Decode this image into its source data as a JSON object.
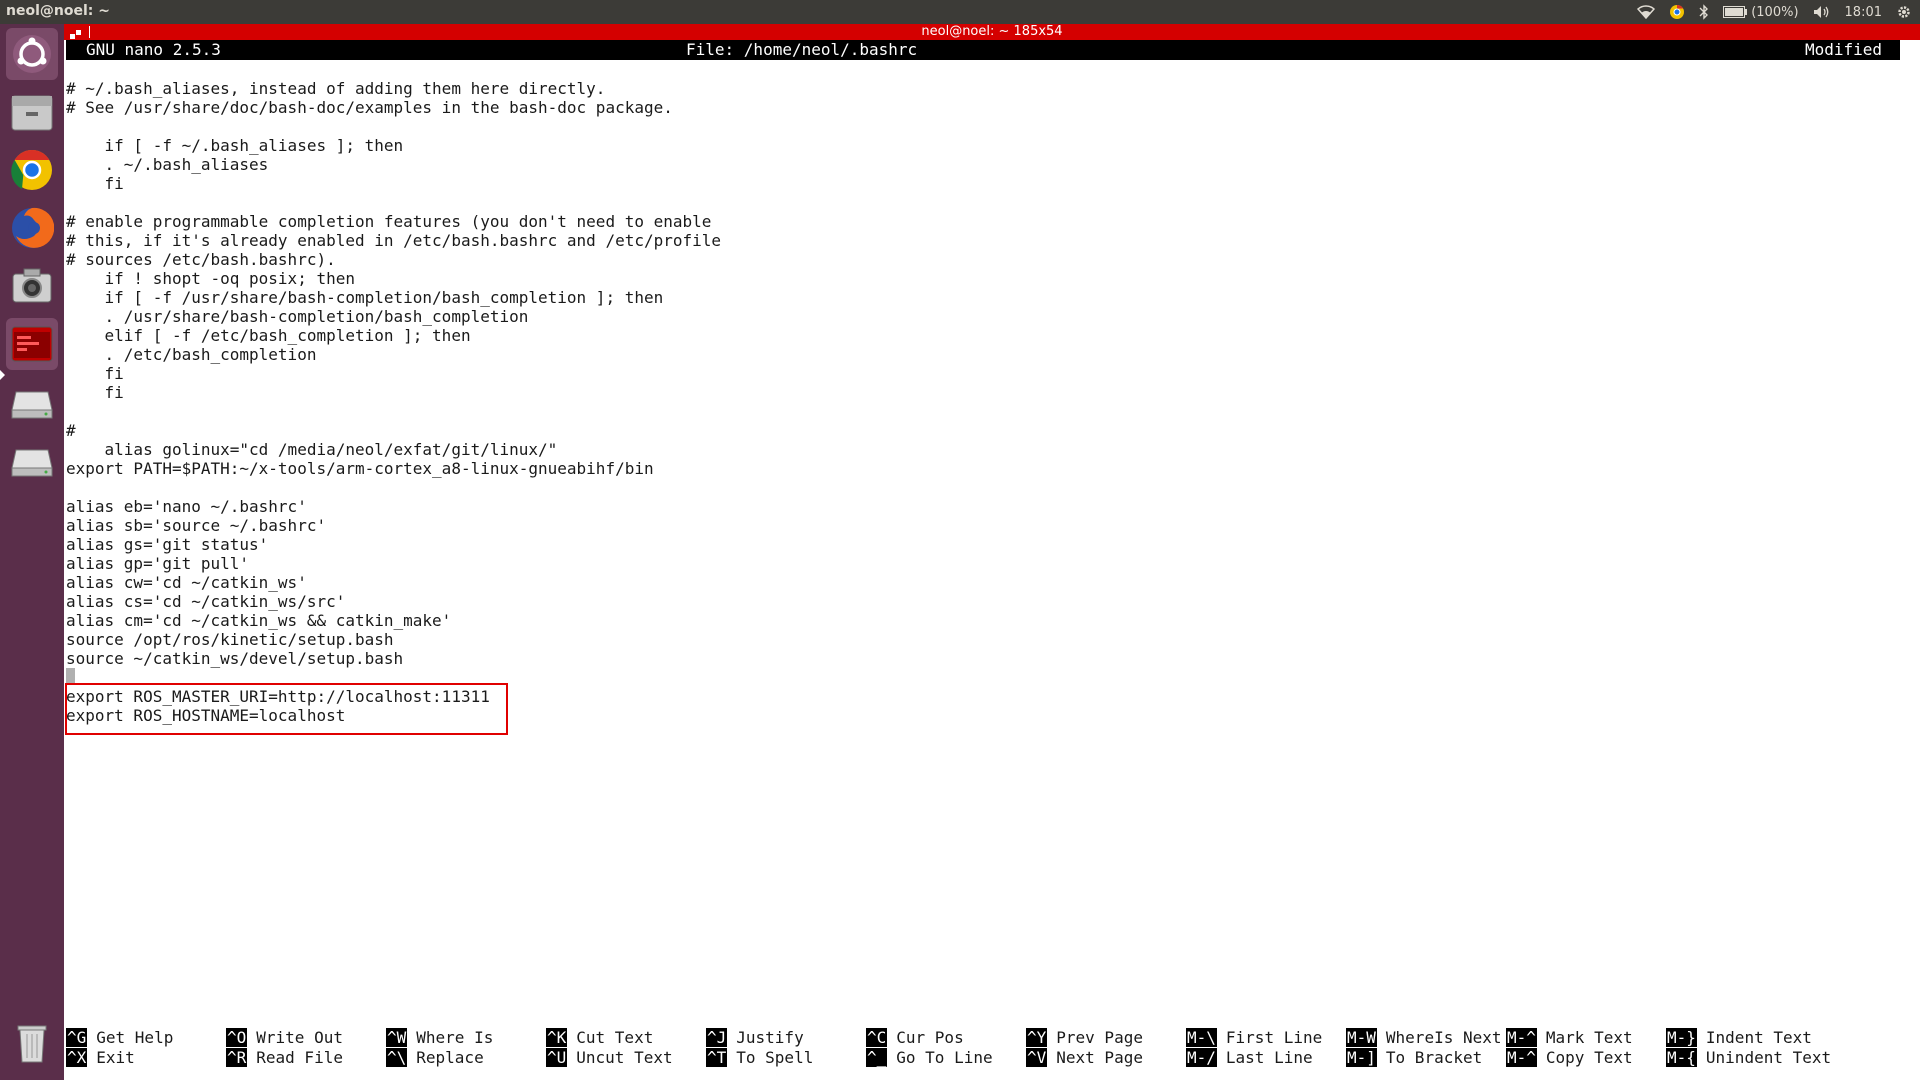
{
  "system_bar": {
    "title": "neol@noel: ~",
    "battery": "(100%)",
    "clock": "18:01"
  },
  "launcher": {
    "items": [
      {
        "name": "dash-icon"
      },
      {
        "name": "files-icon"
      },
      {
        "name": "chrome-icon"
      },
      {
        "name": "firefox-icon"
      },
      {
        "name": "camera-icon"
      },
      {
        "name": "terminal-icon"
      },
      {
        "name": "drive-icon"
      },
      {
        "name": "drive-icon-2"
      },
      {
        "name": "trash-icon"
      }
    ]
  },
  "terminal": {
    "title": "neol@noel: ~ 185x54"
  },
  "nano": {
    "version": "GNU nano 2.5.3",
    "file": "File: /home/neol/.bashrc",
    "status": "Modified"
  },
  "code_lines": [
    "# ~/.bash_aliases, instead of adding them here directly.",
    "# See /usr/share/doc/bash-doc/examples in the bash-doc package.",
    "",
    "    if [ -f ~/.bash_aliases ]; then",
    "    . ~/.bash_aliases",
    "    fi",
    "",
    "# enable programmable completion features (you don't need to enable",
    "# this, if it's already enabled in /etc/bash.bashrc and /etc/profile",
    "# sources /etc/bash.bashrc).",
    "    if ! shopt -oq posix; then",
    "    if [ -f /usr/share/bash-completion/bash_completion ]; then",
    "    . /usr/share/bash-completion/bash_completion",
    "    elif [ -f /etc/bash_completion ]; then",
    "    . /etc/bash_completion",
    "    fi",
    "    fi",
    "",
    "#",
    "    alias golinux=\"cd /media/neol/exfat/git/linux/\"",
    "export PATH=$PATH:~/x-tools/arm-cortex_a8-linux-gnueabihf/bin",
    "",
    "alias eb='nano ~/.bashrc'",
    "alias sb='source ~/.bashrc'",
    "alias gs='git status'",
    "alias gp='git pull'",
    "alias cw='cd ~/catkin_ws'",
    "alias cs='cd ~/catkin_ws/src'",
    "alias cm='cd ~/catkin_ws && catkin_make'",
    "source /opt/ros/kinetic/setup.bash",
    "source ~/catkin_ws/devel/setup.bash",
    "",
    "export ROS_MASTER_URI=http://localhost:11311",
    "export ROS_HOSTNAME=localhost"
  ],
  "shortcuts": [
    {
      "k1": "^G",
      "l1": "Get Help",
      "k2": "^X",
      "l2": "Exit"
    },
    {
      "k1": "^O",
      "l1": "Write Out",
      "k2": "^R",
      "l2": "Read File"
    },
    {
      "k1": "^W",
      "l1": "Where Is",
      "k2": "^\\",
      "l2": "Replace"
    },
    {
      "k1": "^K",
      "l1": "Cut Text",
      "k2": "^U",
      "l2": "Uncut Text"
    },
    {
      "k1": "^J",
      "l1": "Justify",
      "k2": "^T",
      "l2": "To Spell"
    },
    {
      "k1": "^C",
      "l1": "Cur Pos",
      "k2": "^_",
      "l2": "Go To Line"
    },
    {
      "k1": "^Y",
      "l1": "Prev Page",
      "k2": "^V",
      "l2": "Next Page"
    },
    {
      "k1": "M-\\",
      "l1": "First Line",
      "k2": "M-/",
      "l2": "Last Line"
    },
    {
      "k1": "M-W",
      "l1": "WhereIs Next",
      "k2": "M-]",
      "l2": "To Bracket"
    },
    {
      "k1": "M-^",
      "l1": "Mark Text",
      "k2": "M-^",
      "l2": "Copy Text"
    },
    {
      "k1": "M-}",
      "l1": "Indent Text",
      "k2": "M-{",
      "l2": "Unindent Text"
    }
  ],
  "colors": {
    "launcher_bg": "#5a2e4a",
    "terminal_titlebar": "#d40000",
    "highlight_box": "#e00000"
  }
}
